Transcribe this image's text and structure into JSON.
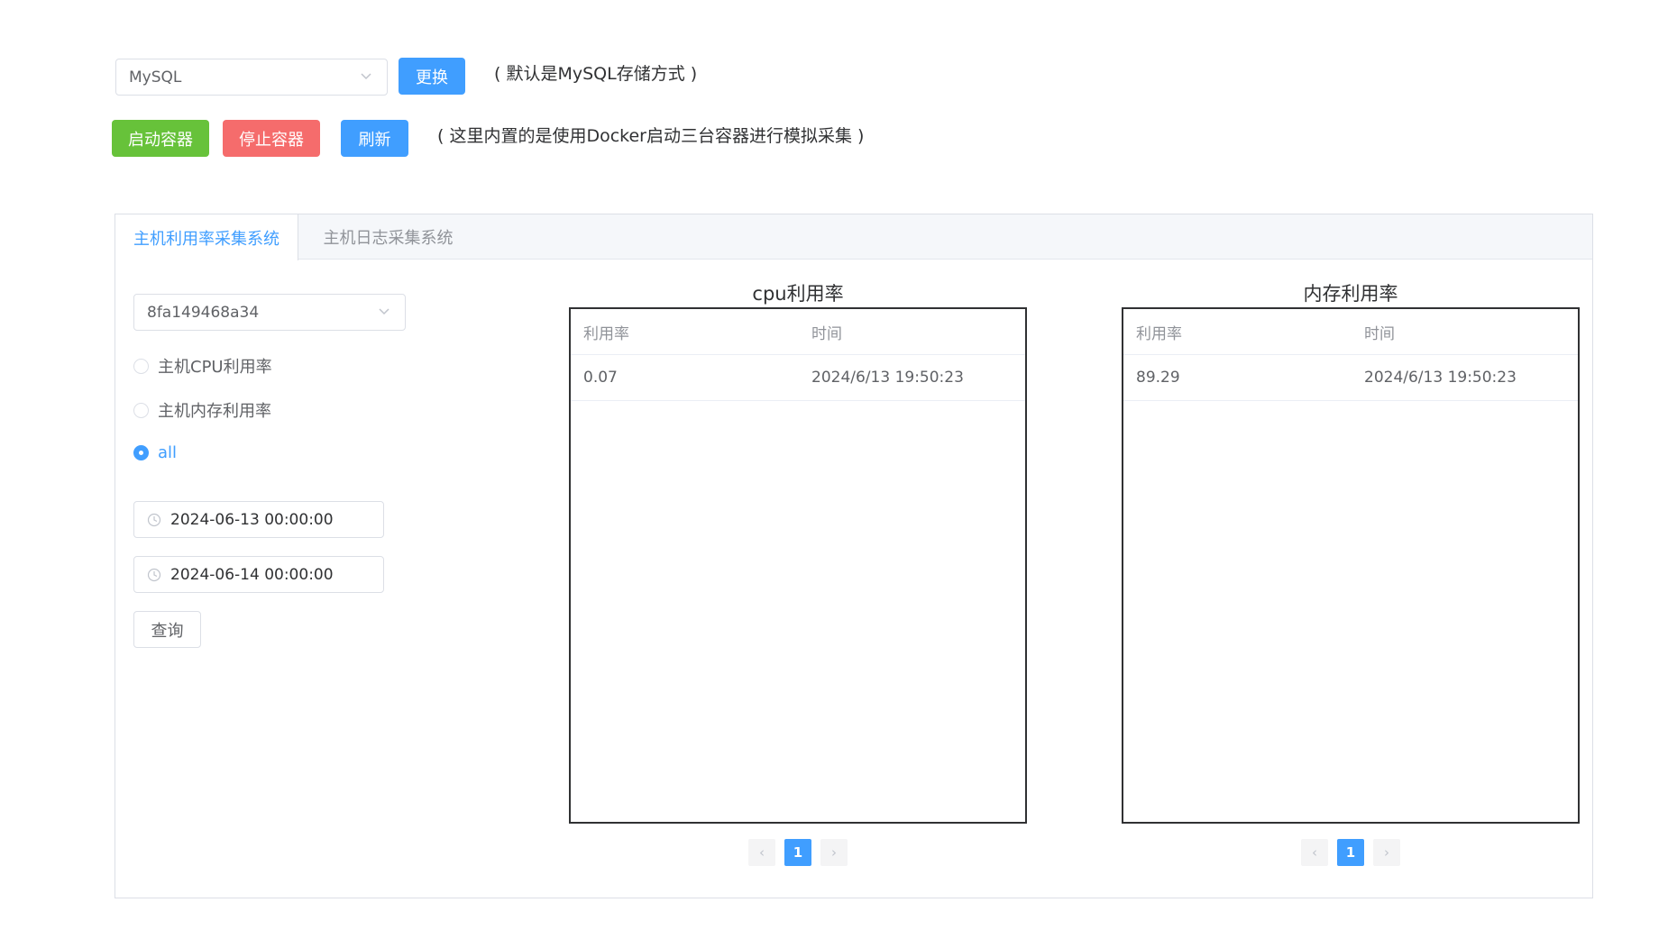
{
  "storage": {
    "selected": "MySQL",
    "change_label": "更换",
    "note": "( 默认是MySQL存储方式 )"
  },
  "containers": {
    "start_label": "启动容器",
    "stop_label": "停止容器",
    "refresh_label": "刷新",
    "note": "( 这里内置的是使用Docker启动三台容器进行模拟采集 )"
  },
  "tabs": [
    {
      "label": "主机利用率采集系统",
      "active": true
    },
    {
      "label": "主机日志采集系统",
      "active": false
    }
  ],
  "filters": {
    "host": "8fa149468a34",
    "radios": [
      {
        "label": "主机CPU利用率",
        "checked": false
      },
      {
        "label": "主机内存利用率",
        "checked": false
      },
      {
        "label": "all",
        "checked": true
      }
    ],
    "start_time": "2024-06-13 00:00:00",
    "end_time": "2024-06-14 00:00:00",
    "query_label": "查询"
  },
  "cpu_table": {
    "title": "cpu利用率",
    "columns": [
      "利用率",
      "时间"
    ],
    "rows": [
      [
        "0.07",
        "2024/6/13 19:50:23"
      ]
    ],
    "page": "1"
  },
  "mem_table": {
    "title": "内存利用率",
    "columns": [
      "利用率",
      "时间"
    ],
    "rows": [
      [
        "89.29",
        "2024/6/13 19:50:23"
      ]
    ],
    "page": "1"
  },
  "colors": {
    "primary": "#409eff",
    "success": "#67c23a",
    "danger": "#f56c6c"
  }
}
